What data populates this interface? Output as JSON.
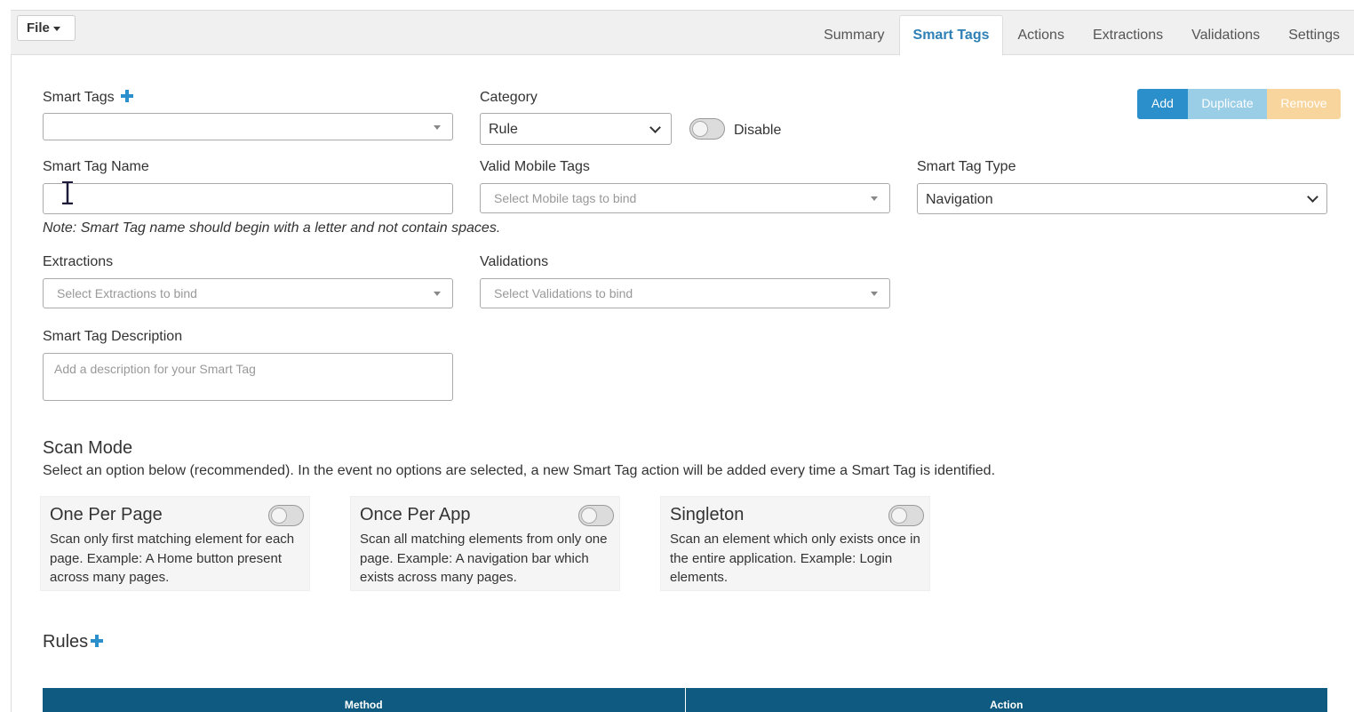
{
  "menu": {
    "file_label": "File"
  },
  "tabs": [
    {
      "label": "Summary",
      "active": false
    },
    {
      "label": "Smart Tags",
      "active": true
    },
    {
      "label": "Actions",
      "active": false
    },
    {
      "label": "Extractions",
      "active": false
    },
    {
      "label": "Validations",
      "active": false
    },
    {
      "label": "Settings",
      "active": false
    }
  ],
  "form": {
    "smart_tags": {
      "label": "Smart Tags",
      "value": ""
    },
    "category": {
      "label": "Category",
      "value": "Rule"
    },
    "disable": {
      "label": "Disable",
      "on": false
    },
    "buttons": {
      "add": "Add",
      "duplicate": "Duplicate",
      "remove": "Remove"
    },
    "smart_tag_name": {
      "label": "Smart Tag Name",
      "value": ""
    },
    "valid_mobile_tags": {
      "label": "Valid Mobile Tags",
      "placeholder": "Select Mobile tags to bind"
    },
    "smart_tag_type": {
      "label": "Smart Tag Type",
      "value": "Navigation"
    },
    "note": "Note: Smart Tag name should begin with a letter and not contain spaces.",
    "extractions": {
      "label": "Extractions",
      "placeholder": "Select Extractions to bind"
    },
    "validations": {
      "label": "Validations",
      "placeholder": "Select Validations to bind"
    },
    "description": {
      "label": "Smart Tag Description",
      "placeholder": "Add a description for your Smart Tag"
    }
  },
  "scan_mode": {
    "title": "Scan Mode",
    "description": "Select an option below (recommended). In the event no options are selected, a new Smart Tag action will be added every time a Smart Tag is identified.",
    "options": [
      {
        "title": "One Per Page",
        "text": "Scan only first matching element for each page. Example: A Home button present across many pages.",
        "on": false
      },
      {
        "title": "Once Per App",
        "text": "Scan all matching elements from only one page. Example: A navigation bar which exists across many pages.",
        "on": false
      },
      {
        "title": "Singleton",
        "text": "Scan an element which only exists once in the entire application. Example: Login elements.",
        "on": false
      }
    ]
  },
  "rules": {
    "title": "Rules",
    "columns": [
      "Method",
      "Action"
    ]
  },
  "colors": {
    "accent": "#2e80b5",
    "add_button": "#2a8fcb",
    "duplicate_button": "#9acde6",
    "remove_button": "#f9d59e",
    "table_header": "#0e5a80"
  },
  "icons": {
    "add_smart_tag": "plus-icon",
    "add_rule": "plus-icon",
    "text_cursor": "i-beam-cursor-icon"
  }
}
